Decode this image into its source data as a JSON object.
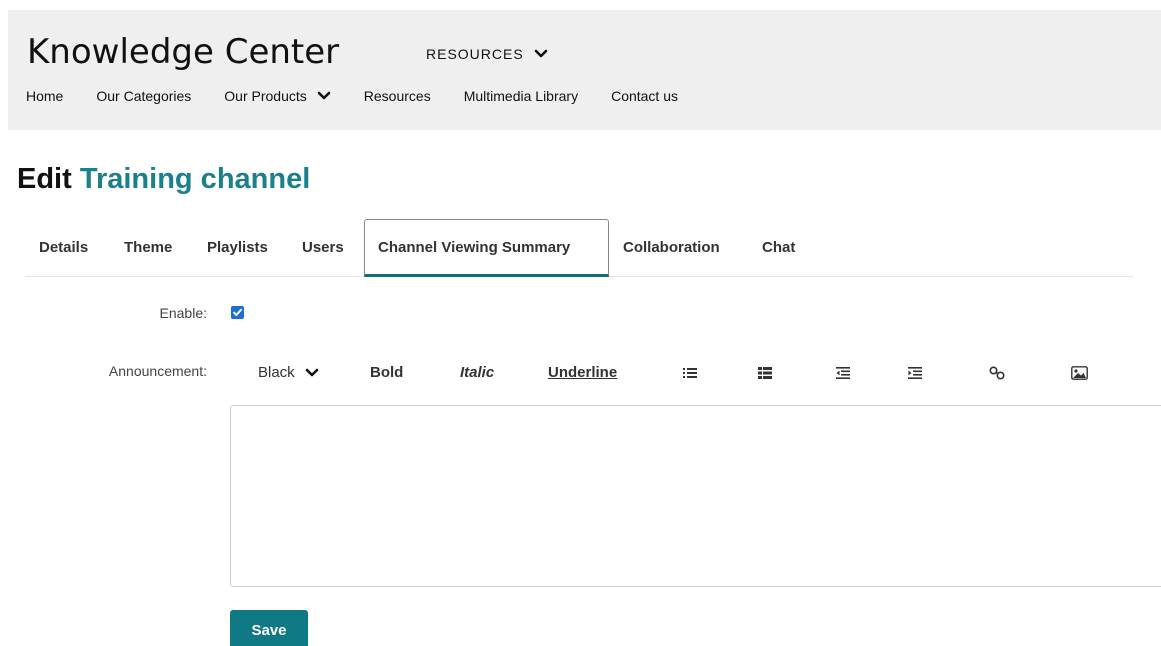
{
  "header": {
    "site_title": "Knowledge Center",
    "resources_menu": "RESOURCES",
    "nav": [
      {
        "label": "Home"
      },
      {
        "label": "Our Categories"
      },
      {
        "label": "Our Products"
      },
      {
        "label": "Resources"
      },
      {
        "label": "Multimedia Library"
      },
      {
        "label": "Contact us"
      }
    ]
  },
  "page": {
    "title_prefix": "Edit",
    "title_channel": "Training channel"
  },
  "tabs": [
    {
      "label": "Details"
    },
    {
      "label": "Theme"
    },
    {
      "label": "Playlists"
    },
    {
      "label": "Users"
    },
    {
      "label": "Channel Viewing Summary",
      "active": true
    },
    {
      "label": "Collaboration"
    },
    {
      "label": "Chat"
    }
  ],
  "form": {
    "enable_label": "Enable:",
    "enable_checked": true,
    "announcement_label": "Announcement:",
    "toolbar": {
      "color_value": "Black",
      "bold": "Bold",
      "italic": "Italic",
      "underline": "Underline"
    },
    "editor_value": "",
    "save_label": "Save"
  },
  "colors": {
    "accent": "#1c7f8c",
    "save_button": "#0f7a86",
    "checkbox": "#1a6fd8",
    "header_bg": "#efefef"
  },
  "icons": [
    "chevron-down-icon",
    "checkmark-icon",
    "bulleted-list-icon",
    "numbered-list-icon",
    "outdent-icon",
    "indent-icon",
    "link-icon",
    "image-icon"
  ]
}
